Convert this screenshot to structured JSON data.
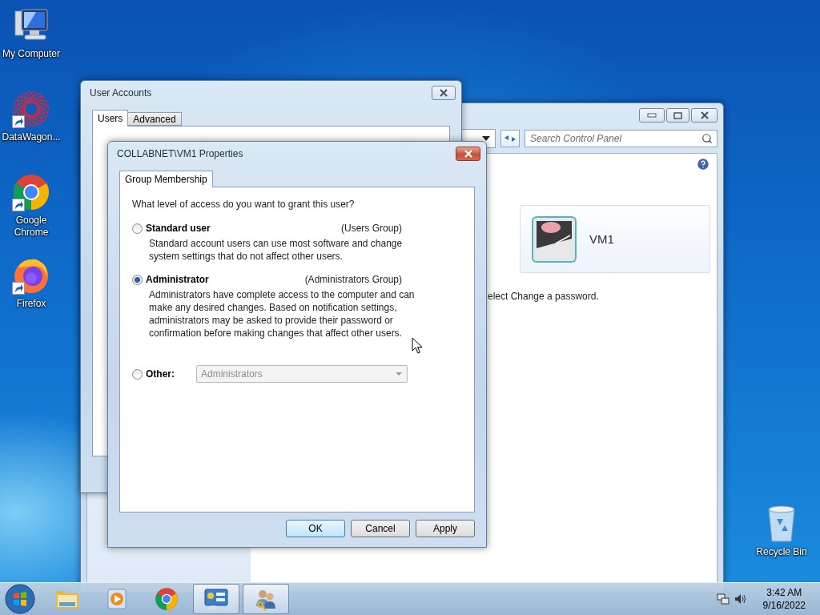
{
  "desktop_icons": [
    {
      "kind": "computer",
      "label": "My Computer"
    },
    {
      "kind": "datawagon",
      "label": "DataWagon..."
    },
    {
      "kind": "chrome",
      "label": "Google Chrome"
    },
    {
      "kind": "firefox",
      "label": "Firefox"
    }
  ],
  "recycle_bin": {
    "label": "Recycle Bin"
  },
  "control_panel": {
    "search": {
      "placeholder": "Search Control Panel"
    },
    "user_tile": {
      "name": "VM1"
    },
    "hint": "elect Change a password."
  },
  "user_accounts": {
    "title": "User Accounts",
    "tabs": [
      {
        "label": "Users",
        "selected": true
      },
      {
        "label": "Advanced",
        "selected": false
      }
    ]
  },
  "properties_dialog": {
    "title": "COLLABNET\\VM1 Properties",
    "tabs": [
      {
        "label": "Group Membership",
        "selected": true
      }
    ],
    "question": "What level of access do you want to grant this user?",
    "options": [
      {
        "kind": "radio",
        "label": "Standard user",
        "group": "(Users Group)",
        "description": "Standard account users can use most software and change system settings that do not affect other users.",
        "selected": false
      },
      {
        "kind": "radio",
        "label": "Administrator",
        "group": "(Administrators Group)",
        "description": "Administrators have complete access to the computer and can make any desired changes. Based on notification settings, administrators may be asked to provide their password or confirmation before making changes that affect other users.",
        "selected": true
      },
      {
        "kind": "dropdown",
        "label": "Other:",
        "value": "Administrators",
        "disabled": true,
        "selected": false
      }
    ],
    "buttons": [
      {
        "label": "OK",
        "default": true
      },
      {
        "label": "Cancel",
        "default": false
      },
      {
        "label": "Apply",
        "default": false
      }
    ]
  },
  "taskbar": {
    "items": [
      {
        "kind": "explorer",
        "open": false
      },
      {
        "kind": "media",
        "open": false
      },
      {
        "kind": "chrome",
        "open": false
      },
      {
        "kind": "control-panel",
        "open": true
      },
      {
        "kind": "users",
        "open": true
      }
    ],
    "clock": {
      "time": "3:42 AM",
      "date": "9/16/2022"
    }
  }
}
